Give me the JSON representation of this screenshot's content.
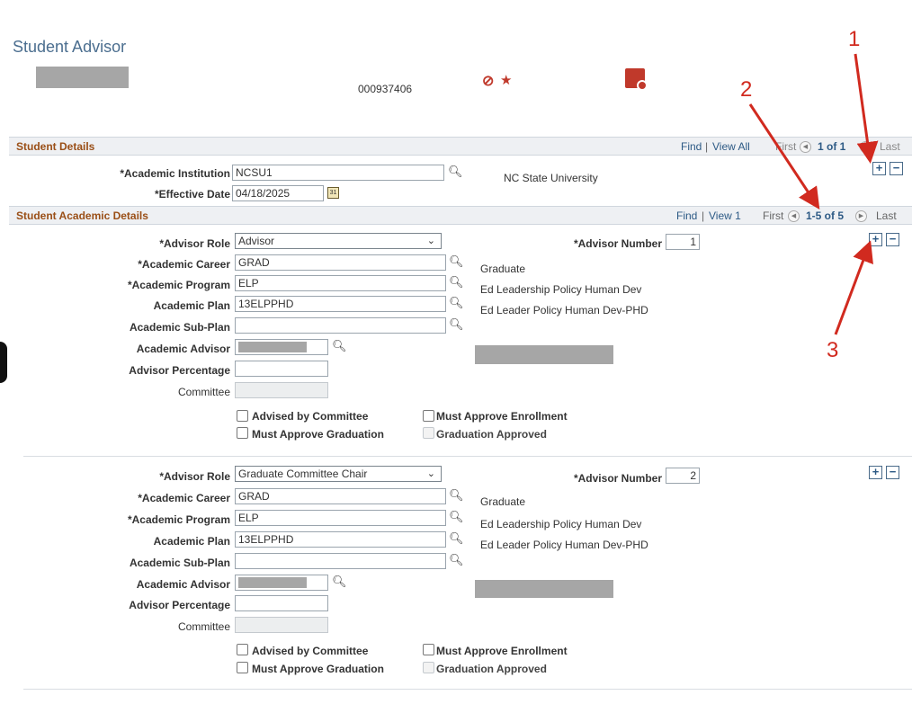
{
  "header": {
    "title": "Student Advisor",
    "student_id": "000937406",
    "icons": [
      "no-entry-icon",
      "star-icon",
      "pdf-report-icon"
    ]
  },
  "student_details": {
    "title": "Student Details",
    "find": "Find",
    "view_all": "View All",
    "first": "First",
    "count": "1 of 1",
    "last": "Last",
    "institution_label": "*Academic Institution",
    "institution_value": "NCSU1",
    "institution_desc": "NC State University",
    "effdt_label": "*Effective Date",
    "effdt_value": "04/18/2025"
  },
  "academic_details": {
    "title": "Student Academic Details",
    "find": "Find",
    "view_1": "View 1",
    "first": "First",
    "count": "1-5 of 5",
    "last": "Last"
  },
  "labels": {
    "advisor_role": "*Advisor Role",
    "advisor_number": "*Advisor Number",
    "academic_career": "*Academic Career",
    "academic_program": "*Academic Program",
    "academic_plan": "Academic Plan",
    "academic_subplan": "Academic Sub-Plan",
    "academic_advisor": "Academic Advisor",
    "advisor_percentage": "Advisor Percentage",
    "committee": "Committee",
    "advised_by_committee": "Advised by Committee",
    "must_approve_enrollment": "Must Approve Enrollment",
    "must_approve_graduation": "Must Approve Graduation",
    "graduation_approved": "Graduation Approved"
  },
  "rows": [
    {
      "advisor_role": "Advisor",
      "advisor_number": "1",
      "career": "GRAD",
      "career_desc": "Graduate",
      "program": "ELP",
      "program_desc": "Ed Leadership Policy Human Dev",
      "plan": "13ELPPHD",
      "plan_desc": "Ed Leader Policy Human Dev-PHD",
      "subplan": "",
      "advisor_percentage": "",
      "committee": ""
    },
    {
      "advisor_role": "Graduate Committee Chair",
      "advisor_number": "2",
      "career": "GRAD",
      "career_desc": "Graduate",
      "program": "ELP",
      "program_desc": "Ed Leadership Policy Human Dev",
      "plan": "13ELPPHD",
      "plan_desc": "Ed Leader Policy Human Dev-PHD",
      "subplan": "",
      "advisor_percentage": "",
      "committee": ""
    }
  ],
  "buttons": {
    "add": "+",
    "delete": "−"
  },
  "annotations": {
    "one": "1",
    "two": "2",
    "three": "3"
  },
  "colors": {
    "section_title": "#9a4f17",
    "link": "#2d5a85",
    "annotation": "#d12a1f"
  }
}
